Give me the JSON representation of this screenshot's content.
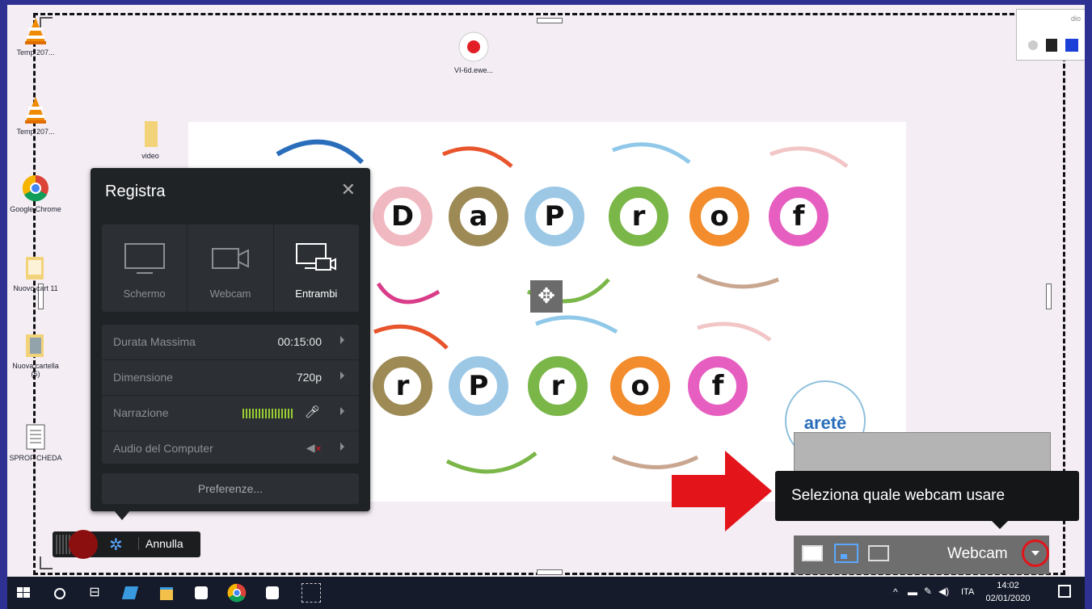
{
  "desktop_icons": [
    {
      "label": "Temp 207..."
    },
    {
      "label": "Temp 207..."
    },
    {
      "label": "Google Chrome"
    },
    {
      "label": "Nuovo cart 11"
    },
    {
      "label": "Nuova cartella (5)"
    },
    {
      "label": "SPROF CHEDA"
    },
    {
      "label": "video"
    },
    {
      "label": "VI-6d.ewe..."
    }
  ],
  "slide": {
    "row1": [
      "D",
      "a",
      "P",
      "r",
      "o",
      "f"
    ],
    "row2": [
      "r",
      "P",
      "r",
      "o",
      "f"
    ],
    "logo_text": "aretè"
  },
  "record_panel": {
    "title": "Registra",
    "modes": [
      {
        "label": "Schermo",
        "icon": "monitor-icon"
      },
      {
        "label": "Webcam",
        "icon": "webcam-icon"
      },
      {
        "label": "Entrambi",
        "icon": "screen-webcam-icon"
      }
    ],
    "settings": {
      "duration_label": "Durata Massima",
      "duration_value": "00:15:00",
      "size_label": "Dimensione",
      "size_value": "720p",
      "narration_label": "Narrazione",
      "audio_label": "Audio del Computer"
    },
    "preferences_label": "Preferenze..."
  },
  "record_bar": {
    "cancel_label": "Annulla"
  },
  "tooltip": {
    "text": "Seleziona quale webcam usare"
  },
  "webcam_panel": {
    "label": "Webcam"
  },
  "top_right_widget": {
    "label": "dio"
  },
  "taskbar": {
    "language": "ITA",
    "time": "14:02",
    "date": "02/01/2020"
  },
  "colors": {
    "border": "#2e3192",
    "panel_bg": "#202326",
    "red_arrow": "#e4141b",
    "highlight_circle": "#e2141b"
  }
}
